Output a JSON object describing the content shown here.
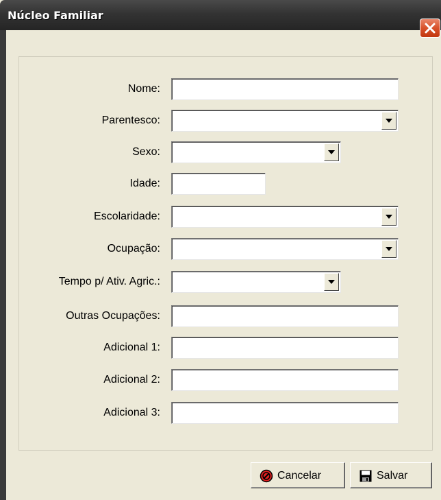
{
  "window": {
    "title": "Núcleo Familiar"
  },
  "form": {
    "nome": {
      "label": "Nome:",
      "value": ""
    },
    "parentesco": {
      "label": "Parentesco:",
      "value": ""
    },
    "sexo": {
      "label": "Sexo:",
      "value": ""
    },
    "idade": {
      "label": "Idade:",
      "value": ""
    },
    "escolaridade": {
      "label": "Escolaridade:",
      "value": ""
    },
    "ocupacao": {
      "label": "Ocupação:",
      "value": ""
    },
    "tempo_ativ_agric": {
      "label": "Tempo p/ Ativ. Agric.:",
      "value": ""
    },
    "outras_ocupacoes": {
      "label": "Outras Ocupações:",
      "value": ""
    },
    "adicional_1": {
      "label": "Adicional 1:",
      "value": ""
    },
    "adicional_2": {
      "label": "Adicional 2:",
      "value": ""
    },
    "adicional_3": {
      "label": "Adicional 3:",
      "value": ""
    }
  },
  "buttons": {
    "cancel_label": "Cancelar",
    "save_label": "Salvar"
  },
  "icons": {
    "close": "close-icon",
    "cancel": "cancel-icon",
    "save": "floppy-disk-icon",
    "dropdown": "chevron-down-icon"
  },
  "colors": {
    "titlebar": "#333333",
    "close_button": "#d8512a",
    "window_background": "#ece9d8",
    "cancel_icon": "#e02020"
  }
}
